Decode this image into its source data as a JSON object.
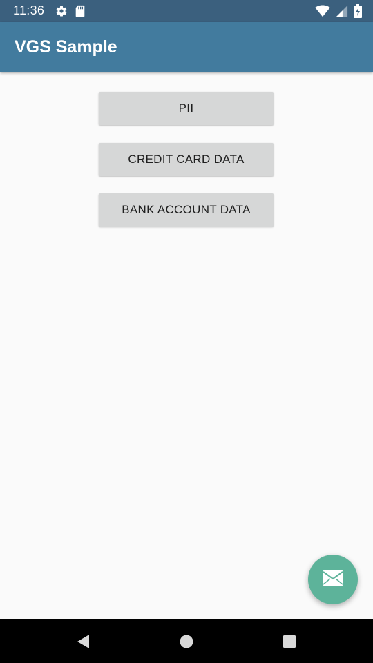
{
  "status_bar": {
    "time": "11:36",
    "icons": [
      "settings-icon",
      "sd-card-icon",
      "wifi-icon",
      "signal-icon",
      "battery-icon"
    ]
  },
  "app_bar": {
    "title": "VGS Sample"
  },
  "buttons": [
    {
      "label": "PII"
    },
    {
      "label": "CREDIT CARD DATA"
    },
    {
      "label": "BANK ACCOUNT DATA"
    }
  ],
  "fab": {
    "icon": "mail-icon"
  },
  "nav_bar": {
    "icons": [
      "back-icon",
      "home-icon",
      "recents-icon"
    ]
  },
  "colors": {
    "status_bar": "#3b607e",
    "app_bar": "#427b9e",
    "button": "#d6d7d7",
    "fab": "#5db39a",
    "background": "#fafafa"
  }
}
